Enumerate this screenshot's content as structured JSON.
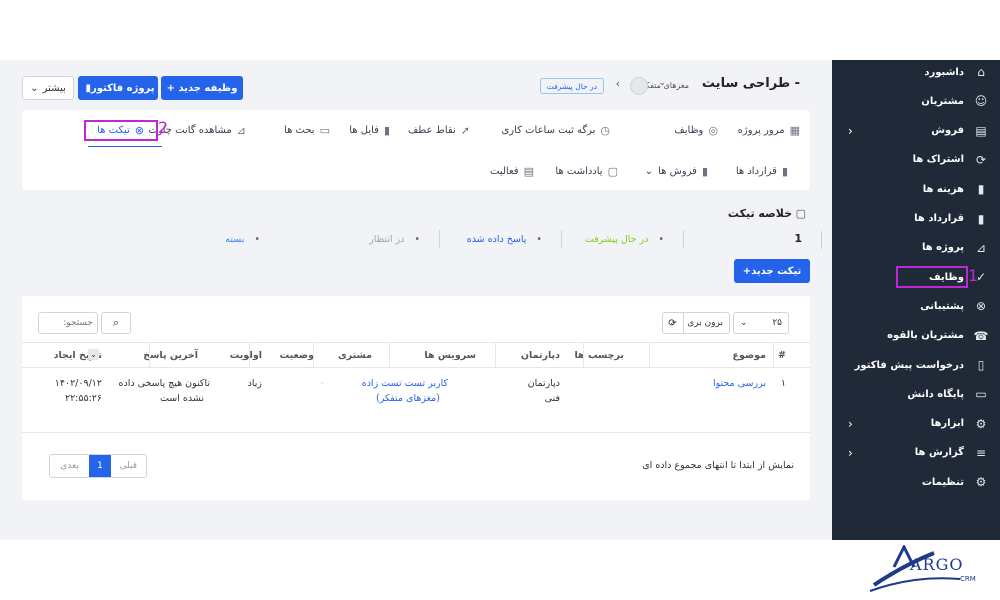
{
  "sidebar": {
    "items": [
      {
        "label": "داشبورد",
        "icon": "home-icon",
        "glyph": "⌂",
        "chevron": false
      },
      {
        "label": "مشتریان",
        "icon": "user-icon",
        "glyph": "☺",
        "chevron": false
      },
      {
        "label": "فروش",
        "icon": "receipt-icon",
        "glyph": "▤",
        "chevron": true
      },
      {
        "label": "اشتراک ها",
        "icon": "refresh-icon",
        "glyph": "⟳",
        "chevron": false
      },
      {
        "label": "هزینه ها",
        "icon": "document-icon",
        "glyph": "▮",
        "chevron": false
      },
      {
        "label": "قرارداد ها",
        "icon": "contract-icon",
        "glyph": "▮",
        "chevron": false
      },
      {
        "label": "پروژه ها",
        "icon": "chart-icon",
        "glyph": "⊿",
        "chevron": false
      },
      {
        "label": "وظایف",
        "icon": "check-circle-icon",
        "glyph": "✓",
        "chevron": false
      },
      {
        "label": "پشتیبانی",
        "icon": "lifebuoy-icon",
        "glyph": "⊗",
        "chevron": false
      },
      {
        "label": "مشتریان بالقوه",
        "icon": "tty-icon",
        "glyph": "☎",
        "chevron": false
      },
      {
        "label": "درخواست پیش فاکتور",
        "icon": "file-icon",
        "glyph": "▯",
        "chevron": false
      },
      {
        "label": "پایگاه دانش",
        "icon": "folder-icon",
        "glyph": "▭",
        "chevron": false
      },
      {
        "label": "ابزارها",
        "icon": "cogs-icon",
        "glyph": "⚙",
        "chevron": true
      },
      {
        "label": "گزارش ها",
        "icon": "report-icon",
        "glyph": "≡",
        "chevron": true
      },
      {
        "label": "تنظیمات",
        "icon": "gear-icon",
        "glyph": "⚙",
        "chevron": false
      }
    ]
  },
  "header": {
    "title": "طراحی سایت -",
    "customer": "مغزهای متفکر",
    "status_badge": "در حال پیشرفت",
    "new_task_btn": "+ وظیفه جدید",
    "invoice_btn": "پروژه فاکتور",
    "more_btn": "بیشتر"
  },
  "tabs": {
    "row1": [
      {
        "label": "مرور پروژه",
        "icon": "table-icon",
        "glyph": "▦"
      },
      {
        "label": "وظایف",
        "icon": "check-circle-icon",
        "glyph": "◎"
      },
      {
        "label": "برگه ثبت ساعات کاری",
        "icon": "clock-icon",
        "glyph": "◷"
      },
      {
        "label": "نقاط عطف",
        "icon": "rocket-icon",
        "glyph": "➚"
      },
      {
        "label": "فایل ها",
        "icon": "file-icon",
        "glyph": "▮"
      },
      {
        "label": "بحث ها",
        "icon": "comment-icon",
        "glyph": "▭"
      },
      {
        "label": "مشاهده گانت چارت",
        "icon": "gantt-icon",
        "glyph": "⊿"
      },
      {
        "label": "تیکت ها",
        "icon": "lifebuoy-icon",
        "glyph": "⊗"
      }
    ],
    "row2": [
      {
        "label": "قرارداد ها",
        "icon": "contract-icon",
        "glyph": "▮"
      },
      {
        "label": "فروش ها",
        "icon": "receipt-icon",
        "glyph": "▮"
      },
      {
        "label": "یادداشت ها",
        "icon": "note-icon",
        "glyph": "▢"
      },
      {
        "label": "فعالیت",
        "icon": "activity-icon",
        "glyph": "▤"
      }
    ]
  },
  "annotations": {
    "one": "1",
    "two": "2"
  },
  "summary": {
    "title": "خلاصه تیکت",
    "count": "1",
    "statuses": [
      {
        "label": "در حال پیشرفت",
        "color": "#84cc16"
      },
      {
        "label": "پاسخ داده شده",
        "color": "#2563eb"
      },
      {
        "label": "در انتظار",
        "color": "#9ca3af"
      },
      {
        "label": "بسته",
        "color": "#3b82f6"
      }
    ],
    "new_ticket_btn": "+تیکت جدید"
  },
  "table": {
    "page_size": "۲۵",
    "export_label": "برون بری",
    "search_placeholder": "جستجو:",
    "columns": [
      "#",
      "موضوع",
      "برچسب ها",
      "دپارتمان",
      "سرویس ها",
      "مشتری",
      "وضعیت",
      "اولویت",
      "آخرین پاسخ",
      "تاریخ ایجاد"
    ],
    "row": {
      "num": "۱",
      "subject": "بررسی محتوا",
      "department_1": "دپارتمان",
      "department_2": "فنی",
      "customer_1": "کاربر تست تست زاده",
      "customer_2": "(مغزهای متفکر)",
      "priority": "زیاد",
      "last_reply_1": "تاکنون هیچ پاسخی داده",
      "last_reply_2": "نشده است",
      "created_1": "۱۴۰۲/۰۹/۱۲",
      "created_2": "۲۲:۵۵:۲۶"
    },
    "info": "نمایش از ابتدا تا انتهای مجموع داده ای",
    "pagination": {
      "prev": "قبلی",
      "page": "1",
      "next": "بعدی"
    }
  },
  "logo": {
    "text": "ARGO",
    "sub": "CRM"
  },
  "colors": {
    "accent": "#2563eb",
    "sidebar": "#1f2937",
    "highlight": "#c026d3"
  }
}
